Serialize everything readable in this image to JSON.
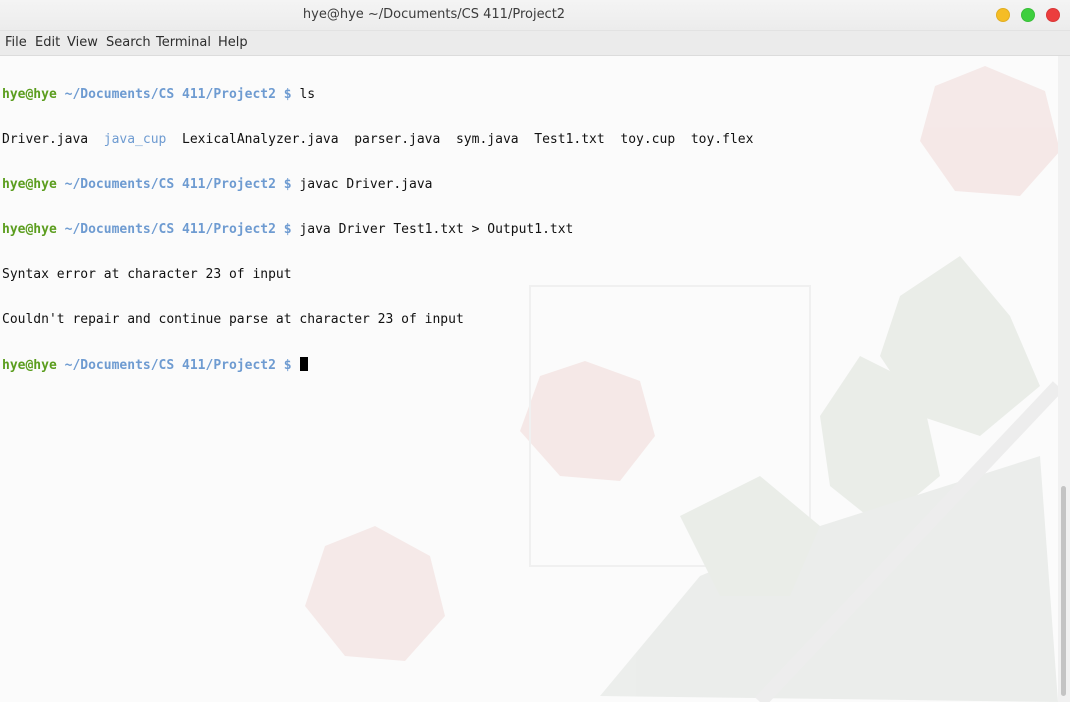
{
  "window": {
    "title": "hye@hye ~/Documents/CS 411/Project2"
  },
  "menu": {
    "items": [
      "File",
      "Edit",
      "View",
      "Search",
      "Terminal",
      "Help"
    ]
  },
  "terminal": {
    "prompt_user": "hye@hye",
    "prompt_path": "~/Documents/CS 411/Project2 $",
    "cmd1": "ls",
    "ls_output": {
      "f1": "Driver.java",
      "f2": "java_cup",
      "f3": "LexicalAnalyzer.java",
      "f4": "parser.java",
      "f5": "sym.java",
      "f6": "Test1.txt",
      "f7": "toy.cup",
      "f8": "toy.flex"
    },
    "cmd2": "javac Driver.java",
    "cmd3": "java Driver Test1.txt > Output1.txt",
    "out1": "Syntax error at character 23 of input",
    "out2": "Couldn't repair and continue parse at character 23 of input",
    "cmd4": ""
  },
  "colors": {
    "prompt_user": "#5b9d1e",
    "prompt_path": "#6e9bd1",
    "directory": "#6e9bd1",
    "text": "#111111"
  }
}
